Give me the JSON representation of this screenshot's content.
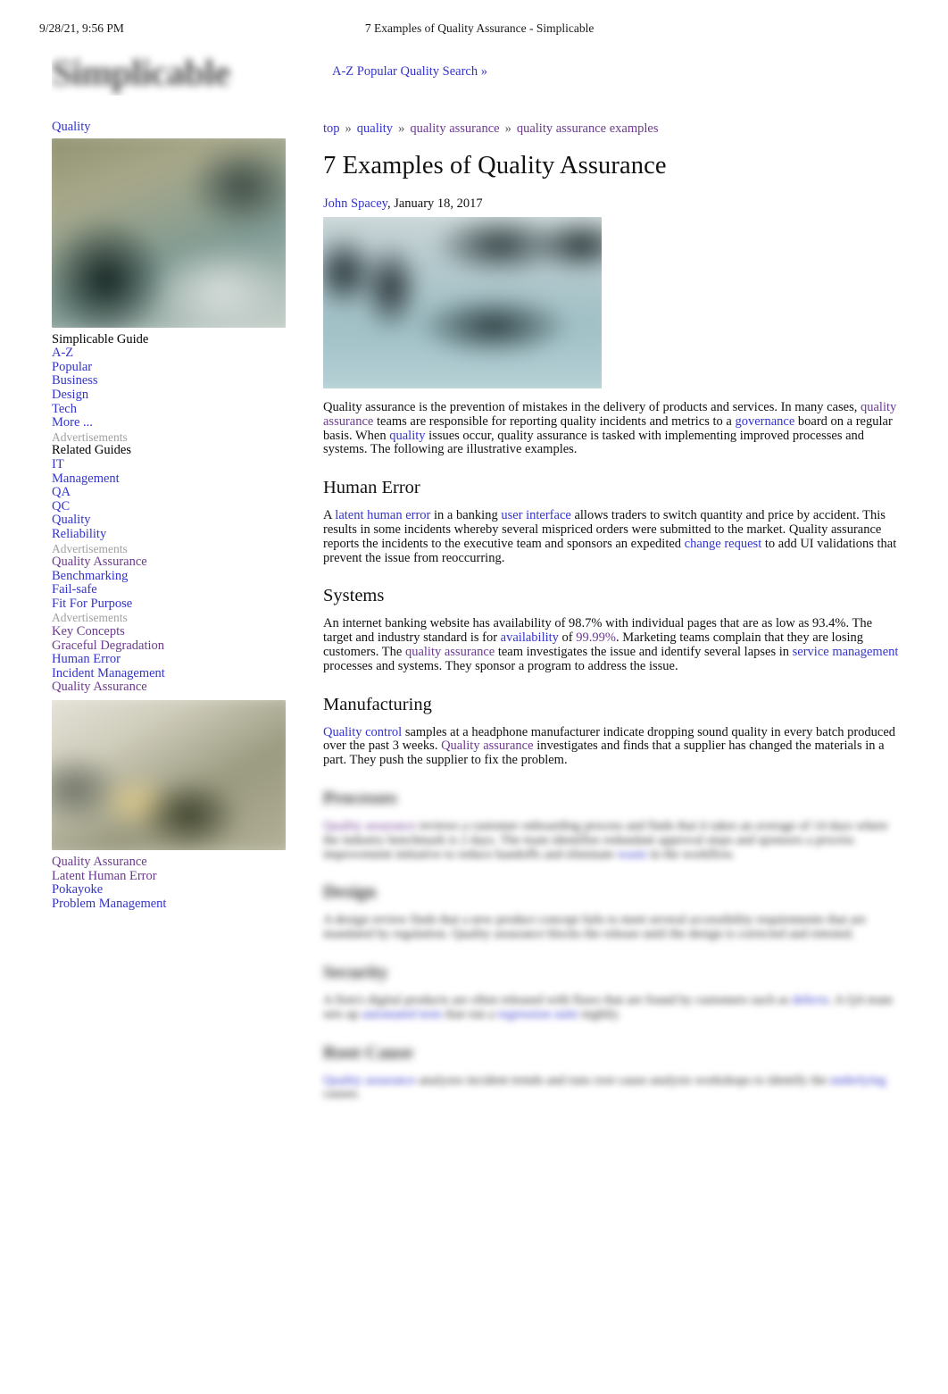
{
  "print_header": {
    "date": "9/28/21, 9:56 PM",
    "doc_title": "7 Examples of Quality Assurance - Simplicable"
  },
  "site": {
    "logo_text": "Simplicable",
    "az_search_link": "A-Z Popular Quality Search »"
  },
  "sidebar": {
    "top_link": "Quality",
    "image_1_alt": "quality-assurance-sidebar-image",
    "guide_heading": "Simplicable Guide",
    "guide_items": [
      {
        "label": "A-Z",
        "visited": false
      },
      {
        "label": "Popular",
        "visited": false
      },
      {
        "label": "Business",
        "visited": false
      },
      {
        "label": "Design",
        "visited": false
      },
      {
        "label": "Tech",
        "visited": false
      },
      {
        "label": "More ...",
        "visited": false
      }
    ],
    "ad_label_1": "Advertisements",
    "related_heading": "Related Guides",
    "related_items": [
      {
        "label": "IT",
        "visited": false
      },
      {
        "label": "Management",
        "visited": false
      },
      {
        "label": "QA",
        "visited": false
      },
      {
        "label": "QC",
        "visited": false
      },
      {
        "label": "Quality",
        "visited": false
      },
      {
        "label": "Reliability",
        "visited": false
      }
    ],
    "ad_label_2": "Advertisements",
    "group_3": [
      {
        "label": "Quality Assurance",
        "visited": true
      },
      {
        "label": "Benchmarking",
        "visited": false
      },
      {
        "label": "Fail-safe",
        "visited": false
      },
      {
        "label": "Fit For Purpose",
        "visited": false
      }
    ],
    "ad_label_3": "Advertisements",
    "group_4": [
      {
        "label": "Key Concepts",
        "visited": true
      },
      {
        "label": "Graceful Degradation",
        "visited": true
      },
      {
        "label": "Human Error",
        "visited": false
      },
      {
        "label": "Incident Management",
        "visited": false
      },
      {
        "label": "Quality Assurance",
        "visited": true
      }
    ],
    "image_2_alt": "related-guides-sidebar-image",
    "group_5": [
      {
        "label": "Quality Assurance",
        "visited": true
      },
      {
        "label": "Latent Human Error",
        "visited": true
      },
      {
        "label": "Pokayoke",
        "visited": false
      },
      {
        "label": "Problem Management",
        "visited": false
      }
    ]
  },
  "breadcrumb": {
    "items": [
      {
        "label": "top",
        "visited": false
      },
      {
        "label": "quality",
        "visited": false
      },
      {
        "label": "quality assurance",
        "visited": true
      },
      {
        "label": "quality assurance examples",
        "visited": true
      }
    ],
    "separator": "»"
  },
  "article": {
    "title": "7 Examples of Quality Assurance",
    "author": "John Spacey",
    "date": "January 18, 2017",
    "hero_image_alt": "quality-assurance-hero-image",
    "intro": {
      "p1_a": "Quality assurance",
      "p1_b": "  is the prevention of mistakes in the delivery of products and services. In many cases, ",
      "link_quality_assurance": "quality assurance",
      "p1_c": " teams are responsible for reporting quality incidents and metrics to a ",
      "link_governance": "governance",
      "p1_d": " board on a regular basis. When ",
      "link_quality": "quality",
      "p1_e": " issues occur, quality assurance is tasked with implementing improved processes and systems. The following are illustrative examples."
    },
    "sections": [
      {
        "heading": "Human Error",
        "blurred": false,
        "parts": [
          {
            "t": "text",
            "v": "A "
          },
          {
            "t": "link",
            "v": "latent human error",
            "visited": false
          },
          {
            "t": "text",
            "v": " in a banking "
          },
          {
            "t": "link",
            "v": "user interface",
            "visited": false
          },
          {
            "t": "text",
            "v": " allows traders to switch quantity and price by accident. This results in some incidents whereby several mispriced orders were submitted to the market. Quality assurance reports the incidents to the executive team and sponsors an expedited "
          },
          {
            "t": "link",
            "v": "change request",
            "visited": false
          },
          {
            "t": "text",
            "v": " to add UI validations that prevent the issue from reoccurring."
          }
        ]
      },
      {
        "heading": "Systems",
        "blurred": false,
        "parts": [
          {
            "t": "text",
            "v": "An internet banking website has availability of 98.7% with individual pages that are as low as 93.4%. The target and industry standard is for "
          },
          {
            "t": "link",
            "v": "availability",
            "visited": false
          },
          {
            "t": "text",
            "v": " of "
          },
          {
            "t": "link",
            "v": "99.99%",
            "visited": true
          },
          {
            "t": "text",
            "v": ". Marketing teams complain that they are losing customers. The "
          },
          {
            "t": "link",
            "v": "quality assurance",
            "visited": true
          },
          {
            "t": "text",
            "v": " team investigates the issue and identify several lapses in "
          },
          {
            "t": "link",
            "v": "service management",
            "visited": false
          },
          {
            "t": "text",
            "v": " processes and systems. They sponsor a program to address the issue."
          }
        ]
      },
      {
        "heading": "Manufacturing",
        "blurred": false,
        "parts": [
          {
            "t": "link",
            "v": "Quality control",
            "visited": false
          },
          {
            "t": "text",
            "v": " samples at a headphone manufacturer indicate dropping sound quality in every batch produced over the past 3 weeks. "
          },
          {
            "t": "link",
            "v": "Quality assurance",
            "visited": true
          },
          {
            "t": "text",
            "v": " investigates and finds that a supplier has changed the materials in a part. They push the supplier to fix the problem."
          }
        ]
      },
      {
        "heading": "Processes",
        "blurred": true,
        "parts": [
          {
            "t": "link",
            "v": "Quality assurance",
            "visited": true
          },
          {
            "t": "text",
            "v": " reviews a customer onboarding process and finds that it takes an average of 14 days where the industry benchmark is 2 days. The team identifies redundant approval steps and sponsors a process improvement initiative to reduce handoffs and eliminate "
          },
          {
            "t": "link",
            "v": "waste",
            "visited": false
          },
          {
            "t": "text",
            "v": " in the workflow."
          }
        ]
      },
      {
        "heading": "Design",
        "blurred": true,
        "parts": [
          {
            "t": "text",
            "v": "A design review finds that a new product concept fails to meet several accessibility requirements that are mandated by regulation. Quality assurance blocks the release until the design is corrected and retested."
          }
        ]
      },
      {
        "heading": "Security",
        "blurred": true,
        "parts": [
          {
            "t": "text",
            "v": "A firm's digital products are often released with flaws that are found by customers such as "
          },
          {
            "t": "link",
            "v": "defects",
            "visited": false
          },
          {
            "t": "text",
            "v": ". A QA team sets up "
          },
          {
            "t": "link",
            "v": "automated tests",
            "visited": false
          },
          {
            "t": "text",
            "v": " that run a "
          },
          {
            "t": "link",
            "v": "regression suite",
            "visited": false
          },
          {
            "t": "text",
            "v": " nightly."
          }
        ]
      },
      {
        "heading": "Root Cause",
        "blurred": true,
        "parts": [
          {
            "t": "link",
            "v": "Quality assurance",
            "visited": false
          },
          {
            "t": "text",
            "v": " analyzes incident trends and runs root cause analysis workshops to identify the "
          },
          {
            "t": "link",
            "v": "underlying",
            "visited": false
          },
          {
            "t": "text",
            "v": " causes."
          }
        ]
      }
    ]
  },
  "colors": {
    "link": "#3333cc",
    "link_visited": "#6b3a8f",
    "text": "#111111",
    "muted": "#a0a0a0",
    "background": "#ffffff"
  }
}
